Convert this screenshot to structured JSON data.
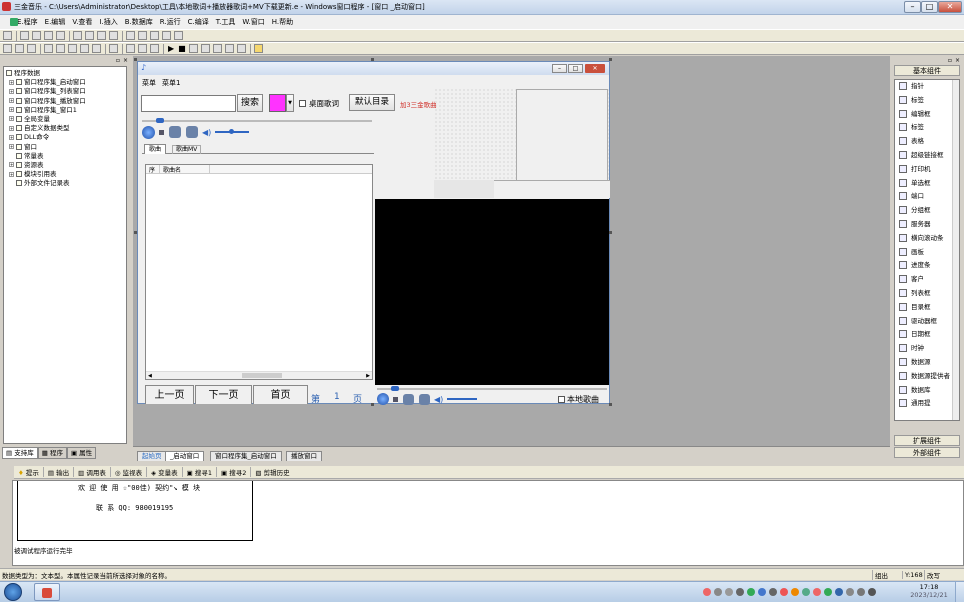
{
  "window": {
    "title": "三金音乐 - C:\\Users\\Administrator\\Desktop\\工具\\本地歌词+播放器歌词+MV下载更新.e - Windows窗口程序 - [窗口 _启动窗口]"
  },
  "menu": [
    "E.程序",
    "E.编辑",
    "V.查看",
    "I.插入",
    "B.数据库",
    "R.运行",
    "C.编译",
    "T.工具",
    "W.窗口",
    "H.帮助"
  ],
  "tree": {
    "root": "程序数据",
    "items": [
      "窗口程序集_启动窗口",
      "窗口程序集_列表窗口",
      "窗口程序集_播放窗口",
      "窗口程序集_窗口1",
      "全局变量",
      "自定义数据类型",
      "DLL命令",
      "窗口",
      "常量表",
      "资源表",
      "模块引用表",
      "外部文件记录表"
    ]
  },
  "left_tabs": [
    "支持库",
    "程序",
    "属性"
  ],
  "form": {
    "menu": [
      "菜单",
      "菜单1"
    ],
    "search_button": "搜索",
    "desktop_lyrics": "桌面歌词",
    "default_dir": "默认目录",
    "brand": "加3三金歌曲",
    "tabs": [
      "歌曲",
      "歌曲MV"
    ],
    "list_headers": [
      "序",
      "歌曲名"
    ],
    "local_songs": "本地歌曲",
    "nav_buttons": [
      "上一页",
      "下一页",
      "首页"
    ],
    "page_label": "第",
    "page_number": "1",
    "page_suffix": "页",
    "swatch_color": "#ff33ff"
  },
  "doc_tabs": [
    "起始页",
    "_启动窗口",
    "窗口程序集_启动窗口",
    "播放窗口"
  ],
  "output_tabs": [
    "提示",
    "输出",
    "调用表",
    "监视表",
    "变量表",
    "搜寻1",
    "搜寻2",
    "剪辑历史"
  ],
  "output": {
    "line1": "欢 迎 使 用 ☆\"00佳) 契约\"↘   模  块",
    "line2": "联 系 QQ: 980019195",
    "status_line": "被调试程序运行完毕"
  },
  "status": {
    "text": "数据类型为：文本型。本属性记录当前所选择对象的名称。",
    "mode": "组出",
    "pos": "Y:168",
    "ins": "改写"
  },
  "right_panel": {
    "header": "基本组件",
    "items": [
      "指针",
      "标签",
      "编辑框",
      "标签",
      "表格",
      "超级链接框",
      "打印机",
      "单选框",
      "端口",
      "分组框",
      "服务器",
      "横向滚动条",
      "画板",
      "进度条",
      "客户",
      "列表框",
      "目录框",
      "驱动器框",
      "日期框",
      "时钟",
      "数据源",
      "数据源提供者",
      "数据库",
      "通用提"
    ],
    "footer": [
      "扩展组件",
      "外部组件"
    ]
  },
  "taskbar": {
    "time": "17:18",
    "date": "2023/12/21"
  }
}
